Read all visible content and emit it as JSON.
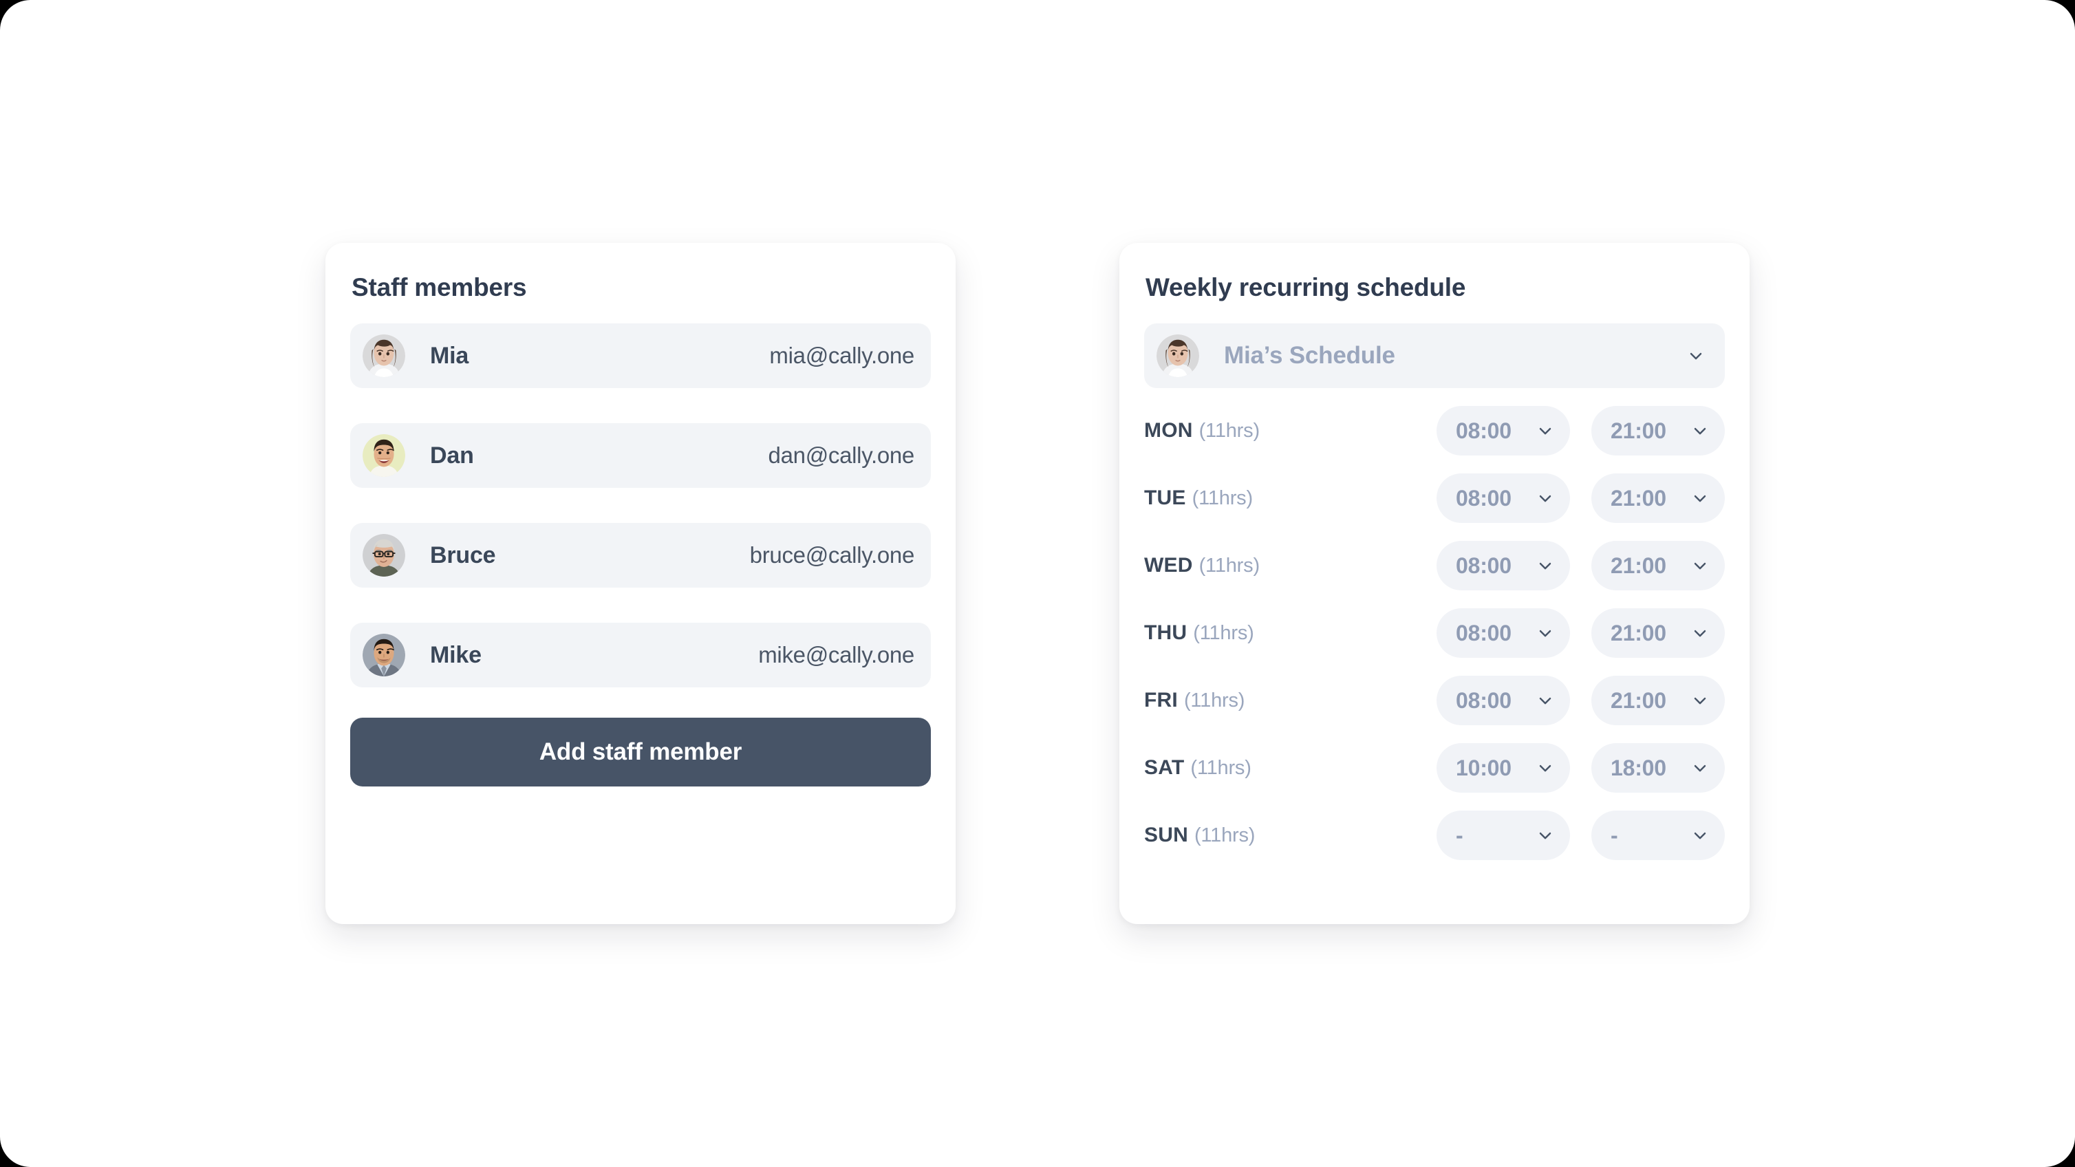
{
  "staff_panel": {
    "title": "Staff members",
    "members": [
      {
        "name": "Mia",
        "email": "mia@cally.one",
        "avatar": "avatar-mia"
      },
      {
        "name": "Dan",
        "email": "dan@cally.one",
        "avatar": "avatar-dan"
      },
      {
        "name": "Bruce",
        "email": "bruce@cally.one",
        "avatar": "avatar-bruce"
      },
      {
        "name": "Mike",
        "email": "mike@cally.one",
        "avatar": "avatar-mike"
      }
    ],
    "add_button_label": "Add staff member"
  },
  "schedule_panel": {
    "title": "Weekly recurring schedule",
    "selector": {
      "label": "Mia’s Schedule",
      "avatar": "avatar-mia",
      "chevron_icon": "chevron-down-icon"
    },
    "days": [
      {
        "day": "MON",
        "hours": "(11hrs)",
        "start": "08:00",
        "end": "21:00"
      },
      {
        "day": "TUE",
        "hours": "(11hrs)",
        "start": "08:00",
        "end": "21:00"
      },
      {
        "day": "WED",
        "hours": "(11hrs)",
        "start": "08:00",
        "end": "21:00"
      },
      {
        "day": "THU",
        "hours": "(11hrs)",
        "start": "08:00",
        "end": "21:00"
      },
      {
        "day": "FRI",
        "hours": "(11hrs)",
        "start": "08:00",
        "end": "21:00"
      },
      {
        "day": "SAT",
        "hours": "(11hrs)",
        "start": "10:00",
        "end": "18:00"
      },
      {
        "day": "SUN",
        "hours": "(11hrs)",
        "start": "-",
        "end": "-"
      }
    ]
  },
  "colors": {
    "page_background": "#ffffff",
    "card_background": "#ffffff",
    "row_background": "#f2f4f7",
    "pill_background": "#f1f3f7",
    "title_text": "#303c50",
    "name_text": "#3a4759",
    "email_text": "#4b5666",
    "muted_text": "#9aa6bd",
    "pill_value_text": "#8f9bb3",
    "button_background": "#475467",
    "button_text": "#ffffff"
  }
}
